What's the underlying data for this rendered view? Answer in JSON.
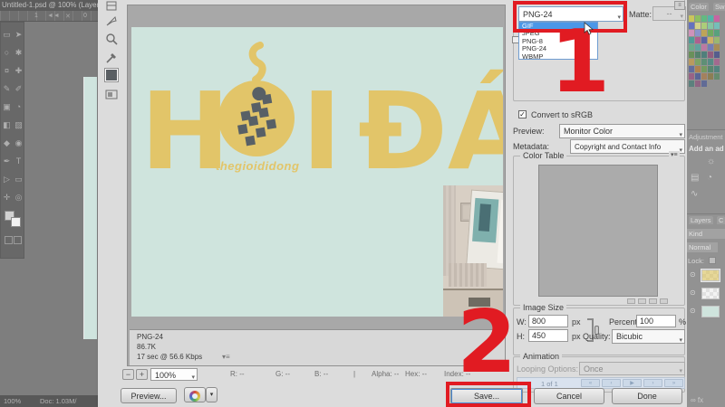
{
  "photoshop": {
    "doc_tab": "Untitled-1.psd @ 100% (Layer 8",
    "tab_scroll_icon": "◄◄",
    "tab_close_icon": "✕",
    "ruler_mark_1": "1",
    "ruler_mark_0": "0",
    "tools_col1": "▭\n○\n¤\n✎\n▣\n◧\n◆\n✒\n▷\n✛",
    "tools_col2": "➤\n✱\n✚\n✐\n◔\n▨\n◉\nT\n▭\n◎",
    "tool_names": [
      "marquee",
      "move",
      "lasso",
      "magic-wand",
      "crop",
      "eyedropper",
      "healing-brush",
      "brush",
      "clone-stamp",
      "history-brush",
      "eraser",
      "gradient",
      "blur",
      "dodge",
      "pen",
      "type",
      "path-select",
      "shape",
      "hand",
      "zoom"
    ],
    "status_zoom": "100%",
    "status_doc": "Doc: 1.03M/"
  },
  "dialog": {
    "toolbar_icon_names": [
      "slice-tool",
      "slice-select-tool",
      "zoom-tool",
      "eyedropper-tool",
      "eyedropper-color-swatch",
      "toggle-slices"
    ],
    "format": {
      "value": "PNG-24",
      "options": [
        "GIF",
        "JPEG",
        "PNG-8",
        "PNG-24",
        "WBMP"
      ],
      "highlighted": "GIF"
    },
    "matte_label": "Matte:",
    "matte_value": "--",
    "optimize_menu_icon": "≡",
    "convert_srgb_label": "Convert to sRGB",
    "convert_srgb_checked": "✓",
    "preview_label": "Preview:",
    "preview_value": "Monitor Color",
    "metadata_label": "Metadata:",
    "metadata_value": "Copyright and Contact Info",
    "color_table_label": "Color Table",
    "color_table_menu_icon": "▾≡",
    "image_size": {
      "title": "Image Size",
      "w_label": "W:",
      "w_value": "800",
      "h_label": "H:",
      "h_value": "450",
      "unit_px": "px",
      "percent_label": "Percent:",
      "percent_value": "100",
      "percent_unit": "%",
      "quality_label": "Quality:",
      "quality_value": "Bicubic"
    },
    "animation": {
      "title": "Animation",
      "looping_label": "Looping Options:",
      "looping_value": "Once",
      "frame_status": "1 of 1",
      "playback_icons": [
        "«",
        "‹",
        "▶",
        "›",
        "»"
      ],
      "playback_names": [
        "first-frame-button",
        "previous-frame-button",
        "play-button",
        "next-frame-button",
        "last-frame-button"
      ]
    },
    "status": {
      "format": "PNG-24",
      "filesize": "86.7K",
      "time": "17 sec @ 56.6 Kbps",
      "menu_icon": "▾≡"
    },
    "zoom": {
      "minus": "−",
      "plus": "+",
      "value": "100%",
      "chevron": "▾"
    },
    "readouts": {
      "r": "R: --",
      "g": "G: --",
      "b": "B: --",
      "divider": "|",
      "alpha": "Alpha: --",
      "hex": "Hex: --",
      "index": "Index: --"
    },
    "buttons": {
      "preview": "Preview...",
      "save": "Save...",
      "cancel": "Cancel",
      "done": "Done"
    }
  },
  "preview_image": {
    "full_title": "HỎI ĐÁ",
    "word_part_h": "H",
    "word_part_i": "I",
    "word_part_da": "ĐÁ",
    "brand": "thegioididong",
    "bg_color": "#cfe4dd",
    "text_color": "#e2c569",
    "mascot_color": "#586066"
  },
  "side_panels": {
    "color_tab": "Color",
    "swatches_tab": "Sw",
    "swatch_rows": [
      [
        "#d8d44f",
        "#8ccb57",
        "#57c47e",
        "#45bcae",
        "#d35ba6",
        "#5a6bcb"
      ],
      [
        "#e3e289",
        "#b3dc74",
        "#83d3a6",
        "#6fc9c3",
        "#df92c4",
        "#8a95da"
      ],
      [
        "#c9a94a",
        "#6aaf54",
        "#4aa578",
        "#3f9e9a",
        "#b5538f",
        "#4f58a8"
      ],
      [
        "#e0b95c",
        "#9cc168",
        "#62b188",
        "#55a8a2",
        "#c773a8",
        "#6f79bd"
      ],
      [
        "#ad8b49",
        "#5f904d",
        "#477f63",
        "#407b76",
        "#93507b",
        "#46508d"
      ],
      [
        "#c49c52",
        "#7aa85a",
        "#528f70",
        "#498a84",
        "#a8618f",
        "#5864a0"
      ],
      [
        "#b57f42",
        "#6f9c54",
        "#4c8567",
        "#44817b",
        "#9b5884",
        "#4e5a96"
      ],
      [
        "#a97e52",
        "#8b7a45",
        "#5c8a66",
        "#4f7d78",
        "#8f5b80",
        "#566298"
      ]
    ],
    "adjustments_tab": "Adjustment",
    "add_adjustment": "Add an ad",
    "adjustment_icon_1": "☼",
    "adjustment_icon_2": "▤",
    "adjustment_icon_3": "◔",
    "adjustment_icon_4": "∿",
    "layers_tab": "Layers",
    "channels_tab": "C",
    "kind_label": "Kind",
    "blend_mode": "Normal",
    "lock_label": "Lock:",
    "eye_icon": "⊙",
    "layers": [
      {
        "thumb": "#e2cd7a"
      },
      {
        "thumb": "#f4f4f4"
      },
      {
        "thumb": "#cfe4dd"
      }
    ],
    "bottom_icons": "∞ fx"
  },
  "annotations": {
    "step_1": "1",
    "step_2": "2",
    "color": "#e11b22"
  }
}
